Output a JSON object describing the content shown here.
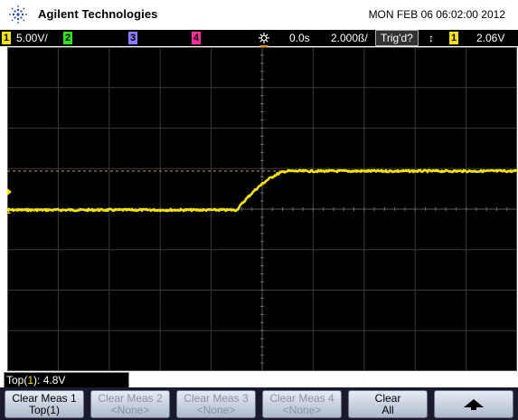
{
  "header": {
    "brand": "Agilent Technologies",
    "datetime": "MON FEB 06 06:02:00 2012"
  },
  "status": {
    "ch1_num": "1",
    "ch1_scale": "5.00V/",
    "ch2_num": "2",
    "ch3_num": "3",
    "ch4_num": "4",
    "time_offset": "0.0s",
    "time_scale": "2.000ß/",
    "trigger_state": "Trig'd?",
    "trig_ch_num": "1",
    "trigger_level": "2.06V"
  },
  "measurement": {
    "label_prefix": "Top(",
    "channel": "1",
    "label_suffix": "): 4.8V"
  },
  "softkeys": [
    {
      "line1": "Clear Meas 1",
      "line2": "Top(1)"
    },
    {
      "line1": "Clear Meas 2",
      "line2": "<None>"
    },
    {
      "line1": "Clear Meas 3",
      "line2": "<None>"
    },
    {
      "line1": "Clear Meas 4",
      "line2": "<None>"
    },
    {
      "line1": "Clear",
      "line2": "All"
    }
  ],
  "trace": {
    "color": "#f5e400",
    "start_level_v": 0.0,
    "final_level_v": 4.8,
    "rise_start_time_s": -1.0,
    "rise_end_time_s": 1.0
  },
  "colors": {
    "ch1": "#f5e400",
    "ch2": "#29e51a",
    "ch3": "#8a7cff",
    "ch4": "#ff2c9c",
    "trigger_marker": "#ff8c00"
  }
}
